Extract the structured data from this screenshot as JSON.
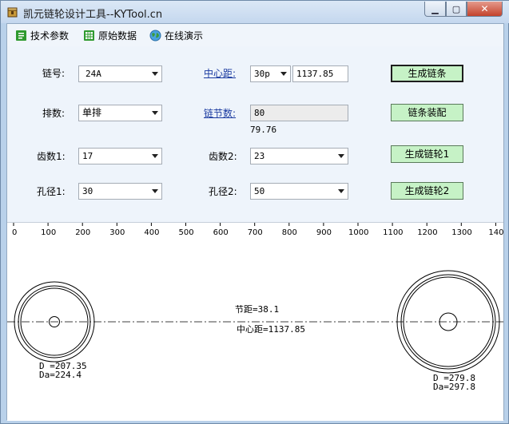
{
  "window": {
    "title": "凯元链轮设计工具--KYTool.cn"
  },
  "toolbar": {
    "tech_params": "技术参数",
    "raw_data": "原始数据",
    "online_demo": "在线演示"
  },
  "form": {
    "chain_no_label": "链号:",
    "chain_no_value": "24A",
    "rows_label": "排数:",
    "rows_value": "单排",
    "teeth1_label": "齿数1:",
    "teeth1_value": "17",
    "bore1_label": "孔径1:",
    "bore1_value": "30",
    "center_label": "中心距:",
    "center_unit": "30p",
    "center_value": "1137.85",
    "links_label": "链节数:",
    "links_value": "80",
    "links_calc": "79.76",
    "teeth2_label": "齿数2:",
    "teeth2_value": "23",
    "bore2_label": "孔径2:",
    "bore2_value": "50",
    "btn_chain": "生成链条",
    "btn_assemble": "链条装配",
    "btn_sprocket1": "生成链轮1",
    "btn_sprocket2": "生成链轮2"
  },
  "drawing": {
    "ruler_ticks": [
      "0",
      "100",
      "200",
      "300",
      "400",
      "500",
      "600",
      "700",
      "800",
      "900",
      "1000",
      "1100",
      "1200",
      "1300",
      "140"
    ],
    "pitch_text": "节距=38.1",
    "center_text": "中心距=1137.85",
    "left_d": "D =207.35",
    "left_da": "Da=224.4",
    "right_d": "D =279.8",
    "right_da": "Da=297.8"
  },
  "colors": {
    "button_green": "#c6f2c6",
    "link_blue": "#1a3aa0"
  }
}
